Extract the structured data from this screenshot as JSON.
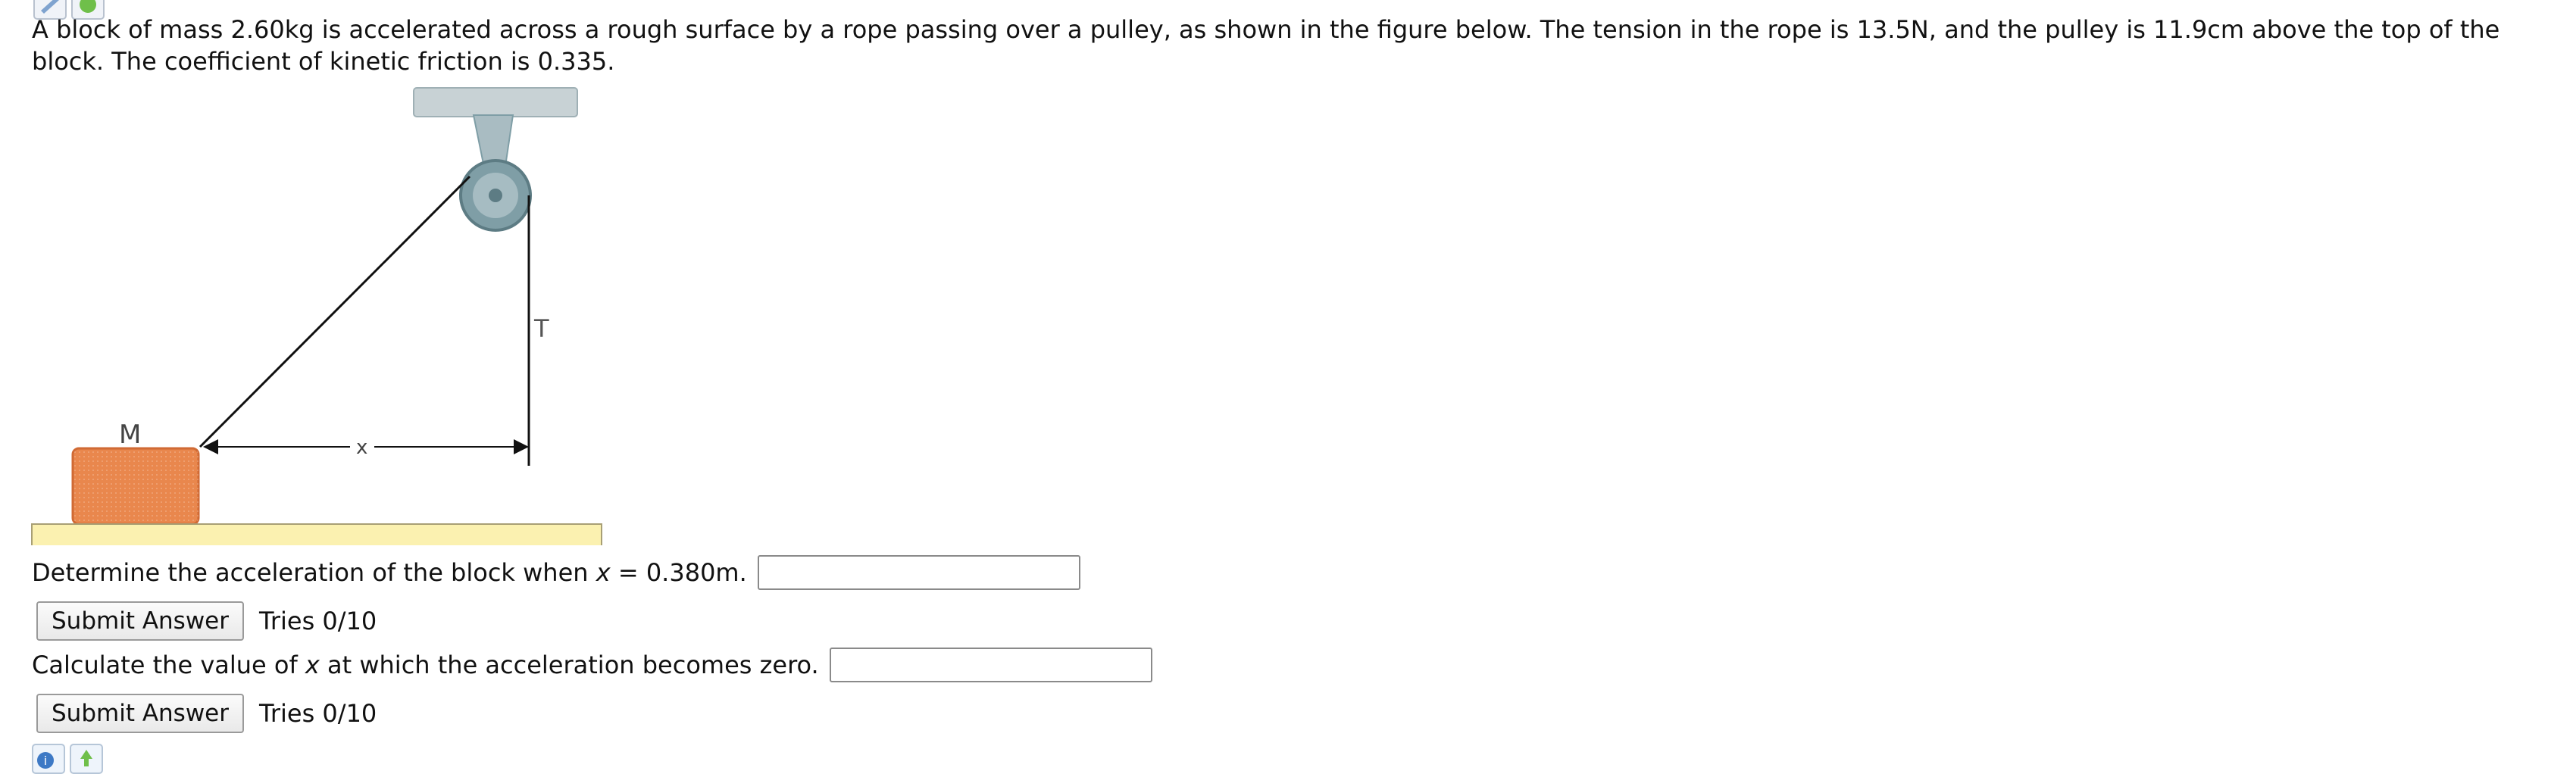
{
  "problem": {
    "statement": "A block of mass 2.60kg is accelerated across a rough surface by a rope passing over a pulley, as shown in the figure below. The tension in the rope is 13.5N, and the pulley is 11.9cm above the top of the block. The coefficient of kinetic friction is 0.335."
  },
  "figure": {
    "mass_label": "M",
    "tension_label": "T",
    "distance_label": "x"
  },
  "questions": [
    {
      "prefix": "Determine the acceleration of the block when ",
      "variable": "x",
      "suffix": " = 0.380m.",
      "input_value": "",
      "submit_label": "Submit Answer",
      "tries": "Tries 0/10"
    },
    {
      "prefix": "Calculate the value of ",
      "variable": "x",
      "suffix": " at which the acceleration becomes zero.",
      "input_value": "",
      "submit_label": "Submit Answer",
      "tries": "Tries 0/10"
    }
  ],
  "icons": {
    "top": [
      "pencil-icon",
      "hint-icon"
    ],
    "bottom": [
      "help-icon",
      "feedback-icon"
    ]
  },
  "colors": {
    "block": "#e9874d",
    "ground": "#fbf1b0",
    "pulley": "#7f9ea6",
    "ceiling": "#c8d2d5"
  }
}
